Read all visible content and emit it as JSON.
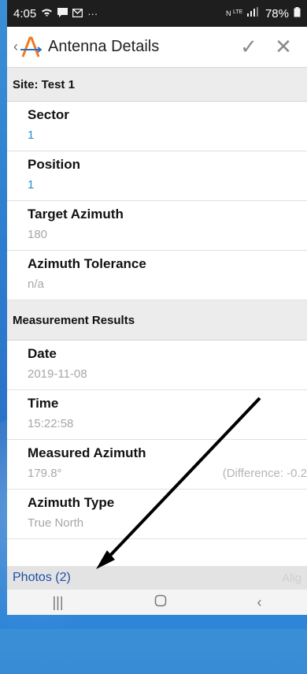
{
  "status": {
    "time": "4:05",
    "battery": "78%"
  },
  "appbar": {
    "title": "Antenna Details"
  },
  "site_header": "Site: Test 1",
  "fields_site": [
    {
      "label": "Sector",
      "value": "1",
      "style": "blue"
    },
    {
      "label": "Position",
      "value": "1",
      "style": "blue"
    },
    {
      "label": "Target Azimuth",
      "value": "180",
      "style": "gray"
    },
    {
      "label": "Azimuth Tolerance",
      "value": "n/a",
      "style": "gray"
    }
  ],
  "measurement_header": "Measurement Results",
  "fields_measure": [
    {
      "label": "Date",
      "value": "2019-11-08"
    },
    {
      "label": "Time",
      "value": "15:22:58"
    },
    {
      "label": "Measured Azimuth",
      "value": "179.8°",
      "extra": "(Difference: -0.2"
    },
    {
      "label": "Azimuth Type",
      "value": "True North"
    }
  ],
  "photos": {
    "label": "Photos (2)",
    "right": "Alig"
  },
  "icons": {
    "wifi": "wifi-icon",
    "message": "message-icon",
    "mail": "mail-icon",
    "menu": "more-icon",
    "signal": "signal-icon",
    "battery": "battery-icon",
    "check": "check-icon",
    "close": "close-icon",
    "back": "back-chevron-icon"
  }
}
